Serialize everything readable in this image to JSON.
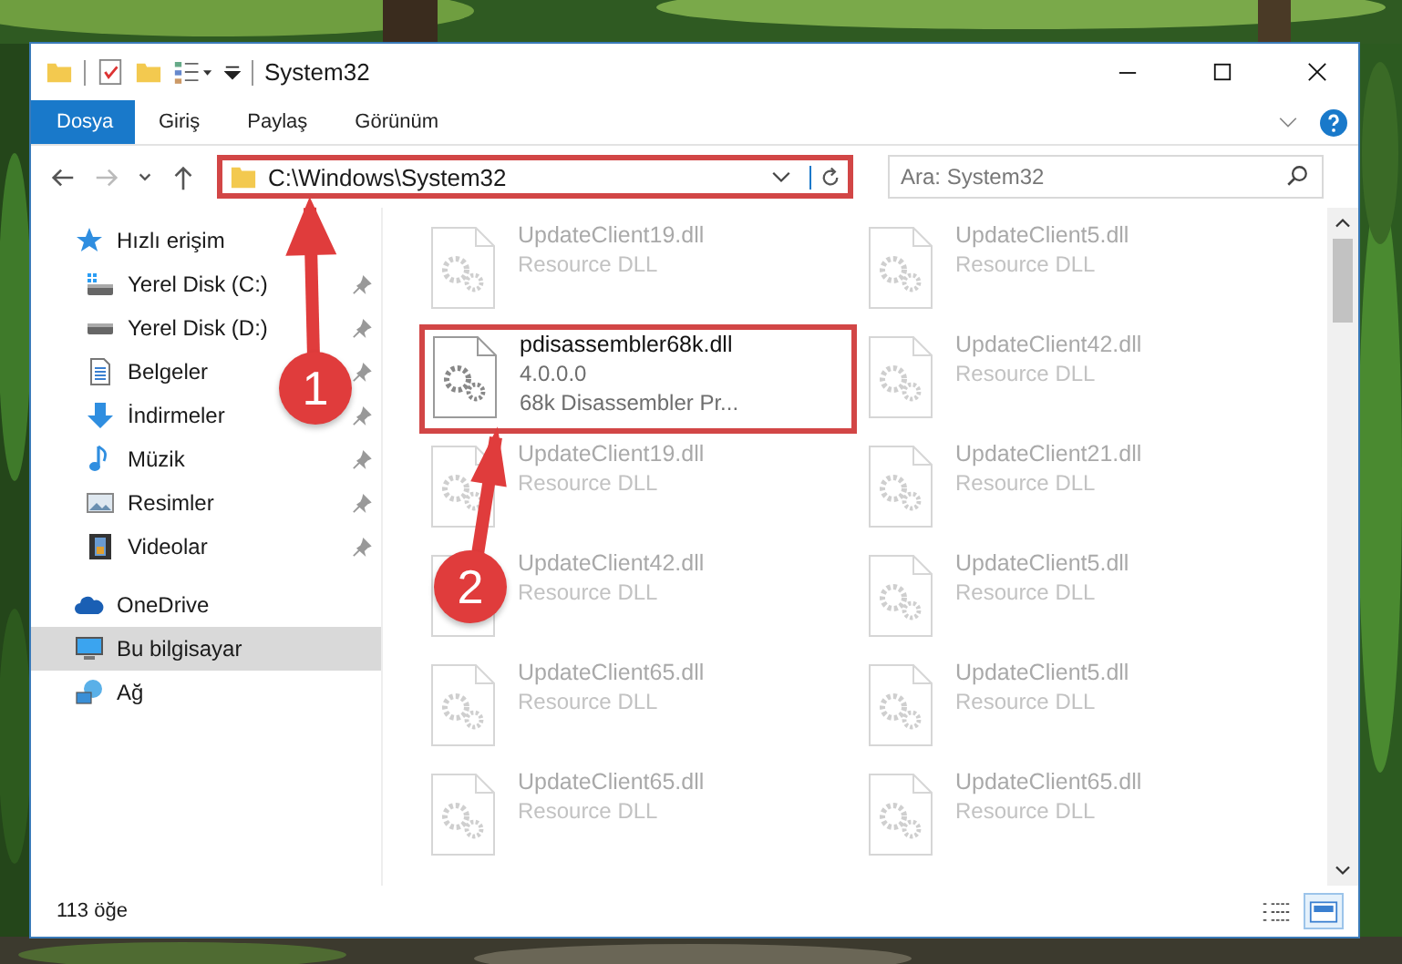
{
  "window": {
    "title": "System32"
  },
  "ribbon_tabs": [
    {
      "label": "Dosya",
      "kind": "file"
    },
    {
      "label": "Giriş",
      "kind": "tab"
    },
    {
      "label": "Paylaş",
      "kind": "tab"
    },
    {
      "label": "Görünüm",
      "kind": "tab"
    }
  ],
  "address": {
    "path": "C:\\Windows\\System32",
    "highlighted": true
  },
  "search": {
    "placeholder": "Ara: System32"
  },
  "sidebar": {
    "items": [
      {
        "label": "Hızlı erişim",
        "kind": "quick",
        "selected": false,
        "children": [
          {
            "label": "Yerel Disk (C:)",
            "kind": "drive-c",
            "pinned": true
          },
          {
            "label": "Yerel Disk (D:)",
            "kind": "drive",
            "pinned": true
          },
          {
            "label": "Belgeler",
            "kind": "docs",
            "pinned": true
          },
          {
            "label": "İndirmeler",
            "kind": "downloads",
            "pinned": true
          },
          {
            "label": "Müzik",
            "kind": "music",
            "pinned": true
          },
          {
            "label": "Resimler",
            "kind": "pictures",
            "pinned": true
          },
          {
            "label": "Videolar",
            "kind": "videos",
            "pinned": true
          }
        ]
      },
      {
        "label": "OneDrive",
        "kind": "cloud",
        "selected": false
      },
      {
        "label": "Bu bilgisayar",
        "kind": "pc",
        "selected": true
      },
      {
        "label": "Ağ",
        "kind": "network",
        "selected": false
      }
    ]
  },
  "files": [
    {
      "name": "UpdateClient19.dll",
      "details": [
        "Resource DLL"
      ],
      "dimmed": true,
      "highlighted": false
    },
    {
      "name": "UpdateClient5.dll",
      "details": [
        "Resource DLL"
      ],
      "dimmed": true,
      "highlighted": false
    },
    {
      "name": "pdisassembler68k.dll",
      "details": [
        "4.0.0.0",
        "68k Disassembler Pr..."
      ],
      "dimmed": false,
      "highlighted": true
    },
    {
      "name": "UpdateClient42.dll",
      "details": [
        "Resource DLL"
      ],
      "dimmed": true,
      "highlighted": false
    },
    {
      "name": "UpdateClient19.dll",
      "details": [
        "Resource DLL"
      ],
      "dimmed": true,
      "highlighted": false
    },
    {
      "name": "UpdateClient21.dll",
      "details": [
        "Resource DLL"
      ],
      "dimmed": true,
      "highlighted": false
    },
    {
      "name": "UpdateClient42.dll",
      "details": [
        "Resource DLL"
      ],
      "dimmed": true,
      "highlighted": false
    },
    {
      "name": "UpdateClient5.dll",
      "details": [
        "Resource DLL"
      ],
      "dimmed": true,
      "highlighted": false
    },
    {
      "name": "UpdateClient65.dll",
      "details": [
        "Resource DLL"
      ],
      "dimmed": true,
      "highlighted": false
    },
    {
      "name": "UpdateClient5.dll",
      "details": [
        "Resource DLL"
      ],
      "dimmed": true,
      "highlighted": false
    },
    {
      "name": "UpdateClient65.dll",
      "details": [
        "Resource DLL"
      ],
      "dimmed": true,
      "highlighted": false
    },
    {
      "name": "UpdateClient65.dll",
      "details": [
        "Resource DLL"
      ],
      "dimmed": true,
      "highlighted": false
    }
  ],
  "status_bar": {
    "count": "113 öğe"
  },
  "view_buttons": [
    {
      "kind": "details",
      "selected": false
    },
    {
      "kind": "tiles",
      "selected": true
    }
  ],
  "annotations": [
    {
      "number": "1"
    },
    {
      "number": "2"
    }
  ]
}
